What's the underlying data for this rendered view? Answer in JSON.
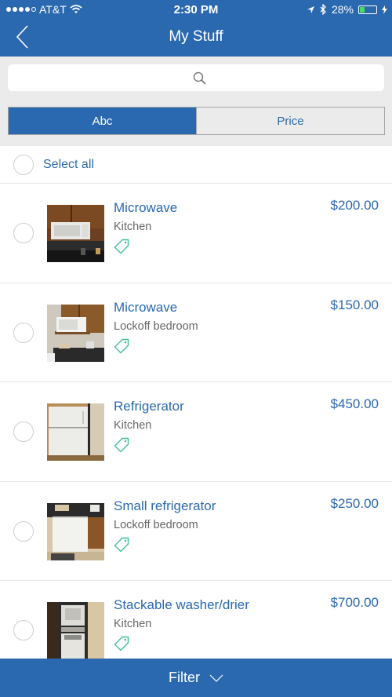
{
  "status_bar": {
    "carrier": "AT&T",
    "time": "2:30 PM",
    "battery": "28%",
    "battery_level": 0.28
  },
  "nav": {
    "title": "My Stuff",
    "back_icon": "chevron-left-icon"
  },
  "search": {
    "placeholder": "",
    "value": "",
    "icon": "search-icon"
  },
  "sort_tabs": [
    {
      "label": "Abc",
      "active": true
    },
    {
      "label": "Price",
      "active": false
    }
  ],
  "select_all": {
    "label": "Select all",
    "checked": false
  },
  "items": [
    {
      "name": "Microwave",
      "room": "Kitchen",
      "price": "$200.00",
      "image": "microwave-over-range"
    },
    {
      "name": "Microwave",
      "room": "Lockoff bedroom",
      "price": "$150.00",
      "image": "microwave-on-shelf"
    },
    {
      "name": "Refrigerator",
      "room": "Kitchen",
      "price": "$450.00",
      "image": "refrigerator"
    },
    {
      "name": "Small refrigerator",
      "room": "Lockoff bedroom",
      "price": "$250.00",
      "image": "small-refrigerator"
    },
    {
      "name": "Stackable washer/drier",
      "room": "Kitchen",
      "price": "$700.00",
      "image": "stackable-washer-drier"
    }
  ],
  "footer": {
    "label": "Filter",
    "icon": "chevron-down-icon"
  },
  "colors": {
    "brand": "#2a69b0",
    "tag": "#3dbf9a",
    "battery": "#4cd964"
  }
}
